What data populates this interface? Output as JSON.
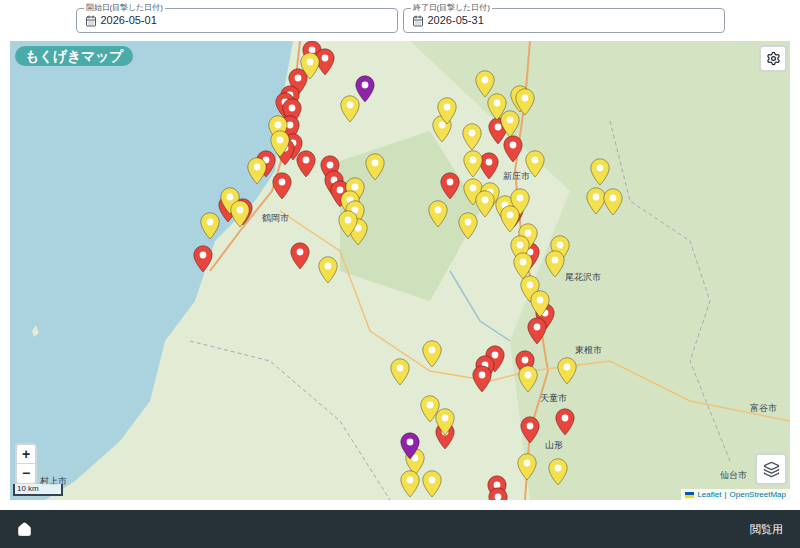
{
  "date_filters": [
    {
      "label": "開始日(目撃した日付)",
      "value": "2026-05-01"
    },
    {
      "label": "終了日(目撃した日付)",
      "value": "2026-05-31"
    }
  ],
  "map": {
    "title": "もくげきマップ",
    "zoom_in": "+",
    "zoom_out": "−",
    "scale": "10 km",
    "attribution_links": [
      "Leaflet",
      "OpenStreetMap"
    ],
    "attribution_separator": "|",
    "place_labels": [
      "鶴岡市",
      "新庄市",
      "尾花沢市",
      "東根市",
      "天童市",
      "山形",
      "村上市",
      "仙台市",
      "富谷市"
    ],
    "pins": [
      {
        "color": "#e8453c"
      },
      {
        "color": "#e8453c"
      },
      {
        "color": "#e8453c"
      },
      {
        "color": "#e8453c"
      },
      {
        "color": "#e8453c"
      },
      {
        "color": "#e8453c"
      },
      {
        "color": "#e8453c"
      },
      {
        "color": "#e8453c"
      },
      {
        "color": "#e8453c"
      },
      {
        "color": "#e8453c"
      },
      {
        "color": "#e8453c"
      },
      {
        "color": "#e8453c"
      },
      {
        "color": "#e8453c"
      },
      {
        "color": "#e8453c"
      },
      {
        "color": "#e8453c"
      },
      {
        "color": "#e8453c"
      },
      {
        "color": "#e8453c"
      },
      {
        "color": "#e8453c"
      },
      {
        "color": "#e8453c"
      },
      {
        "color": "#e8453c"
      },
      {
        "color": "#e8453c"
      },
      {
        "color": "#e8453c"
      },
      {
        "color": "#e8453c"
      },
      {
        "color": "#e8453c"
      },
      {
        "color": "#e8453c"
      },
      {
        "color": "#e8453c"
      },
      {
        "color": "#e8453c"
      },
      {
        "color": "#e8453c"
      },
      {
        "color": "#e8453c"
      },
      {
        "color": "#e8453c"
      },
      {
        "color": "#e8453c"
      },
      {
        "color": "#e8453c"
      },
      {
        "color": "#e8453c"
      },
      {
        "color": "#e8453c"
      },
      {
        "color": "#e8453c"
      },
      {
        "color": "#e8453c"
      },
      {
        "color": "#f4e04d"
      },
      {
        "color": "#f4e04d"
      },
      {
        "color": "#f4e04d"
      },
      {
        "color": "#f4e04d"
      },
      {
        "color": "#f4e04d"
      },
      {
        "color": "#f4e04d"
      },
      {
        "color": "#f4e04d"
      },
      {
        "color": "#f4e04d"
      },
      {
        "color": "#f4e04d"
      },
      {
        "color": "#f4e04d"
      },
      {
        "color": "#f4e04d"
      },
      {
        "color": "#f4e04d"
      },
      {
        "color": "#f4e04d"
      },
      {
        "color": "#f4e04d"
      },
      {
        "color": "#f4e04d"
      },
      {
        "color": "#f4e04d"
      },
      {
        "color": "#f4e04d"
      },
      {
        "color": "#f4e04d"
      },
      {
        "color": "#f4e04d"
      },
      {
        "color": "#f4e04d"
      },
      {
        "color": "#f4e04d"
      },
      {
        "color": "#f4e04d"
      },
      {
        "color": "#f4e04d"
      },
      {
        "color": "#f4e04d"
      },
      {
        "color": "#f4e04d"
      },
      {
        "color": "#f4e04d"
      },
      {
        "color": "#f4e04d"
      },
      {
        "color": "#f4e04d"
      },
      {
        "color": "#f4e04d"
      },
      {
        "color": "#f4e04d"
      },
      {
        "color": "#f4e04d"
      },
      {
        "color": "#f4e04d"
      },
      {
        "color": "#f4e04d"
      },
      {
        "color": "#f4e04d"
      },
      {
        "color": "#f4e04d"
      },
      {
        "color": "#f4e04d"
      },
      {
        "color": "#f4e04d"
      },
      {
        "color": "#f4e04d"
      },
      {
        "color": "#f4e04d"
      },
      {
        "color": "#f4e04d"
      },
      {
        "color": "#f4e04d"
      },
      {
        "color": "#f4e04d"
      },
      {
        "color": "#f4e04d"
      },
      {
        "color": "#f4e04d"
      },
      {
        "color": "#f4e04d"
      },
      {
        "color": "#f4e04d"
      },
      {
        "color": "#f4e04d"
      },
      {
        "color": "#f4e04d"
      },
      {
        "color": "#f4e04d"
      },
      {
        "color": "#f4e04d"
      },
      {
        "color": "#f4e04d"
      },
      {
        "color": "#f4e04d"
      },
      {
        "color": "#f4e04d"
      },
      {
        "color": "#f4e04d"
      },
      {
        "color": "#8e24aa"
      },
      {
        "color": "#8e24aa"
      }
    ]
  },
  "bottom_bar": {
    "label": "閲覧用"
  }
}
